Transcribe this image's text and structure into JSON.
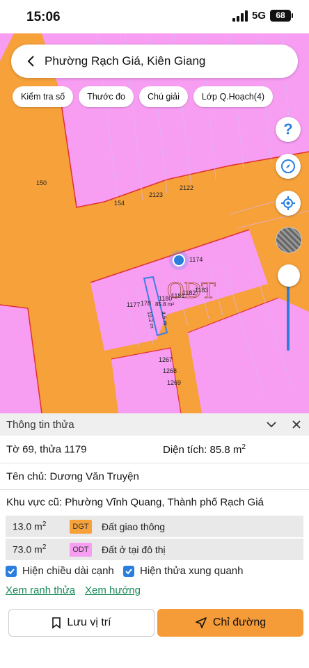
{
  "status_bar": {
    "time": "15:06",
    "network": "5G",
    "battery": "68"
  },
  "search": {
    "title": "Phường Rạch Giá, Kiên Giang"
  },
  "chips": [
    {
      "label": "Kiểm tra số"
    },
    {
      "label": "Thước đo"
    },
    {
      "label": "Chú giải"
    },
    {
      "label": "Lớp Q.Hoạch(4)"
    }
  ],
  "map": {
    "zone_label": "ODT",
    "plot_labels": [
      "150",
      "154",
      "2123",
      "2122",
      "1174",
      "1177",
      "178",
      "1180",
      "1181",
      "1182",
      "1183",
      "1267",
      "1268",
      "1269"
    ],
    "area_label": "85.8 m²",
    "dim_label_1": "19.2 m",
    "dim_label_2": "4.5 m"
  },
  "panel": {
    "title": "Thông tin thửa",
    "sheet_plot": "Tờ 69, thửa 1179",
    "area_label": "Diện tích: 85.8 m",
    "area_sup": "2",
    "owner": "Tên chủ: Dương Văn Truyện",
    "old_area": "Khu vực cũ: Phường Vĩnh Quang, Thành phố Rạch Giá",
    "zones": [
      {
        "area": "13.0 m",
        "sup": "2",
        "code": "DGT",
        "desc": "Đất giao thông",
        "color": "#f6a13a"
      },
      {
        "area": "73.0 m",
        "sup": "2",
        "code": "ODT",
        "desc": "Đất ở tại đô thị",
        "color": "#f79df2"
      }
    ],
    "check_edge": "Hiện chiều dài cạnh",
    "check_neighbors": "Hiện thửa xung quanh",
    "link_boundary": "Xem ranh thửa",
    "link_direction": "Xem hướng",
    "btn_save": "Lưu vị trí",
    "btn_route": "Chỉ đường"
  },
  "colors": {
    "orange": "#f6a13a",
    "pink": "#f79df2",
    "blue": "#2a7fde",
    "link_green": "#1a8a5a"
  }
}
